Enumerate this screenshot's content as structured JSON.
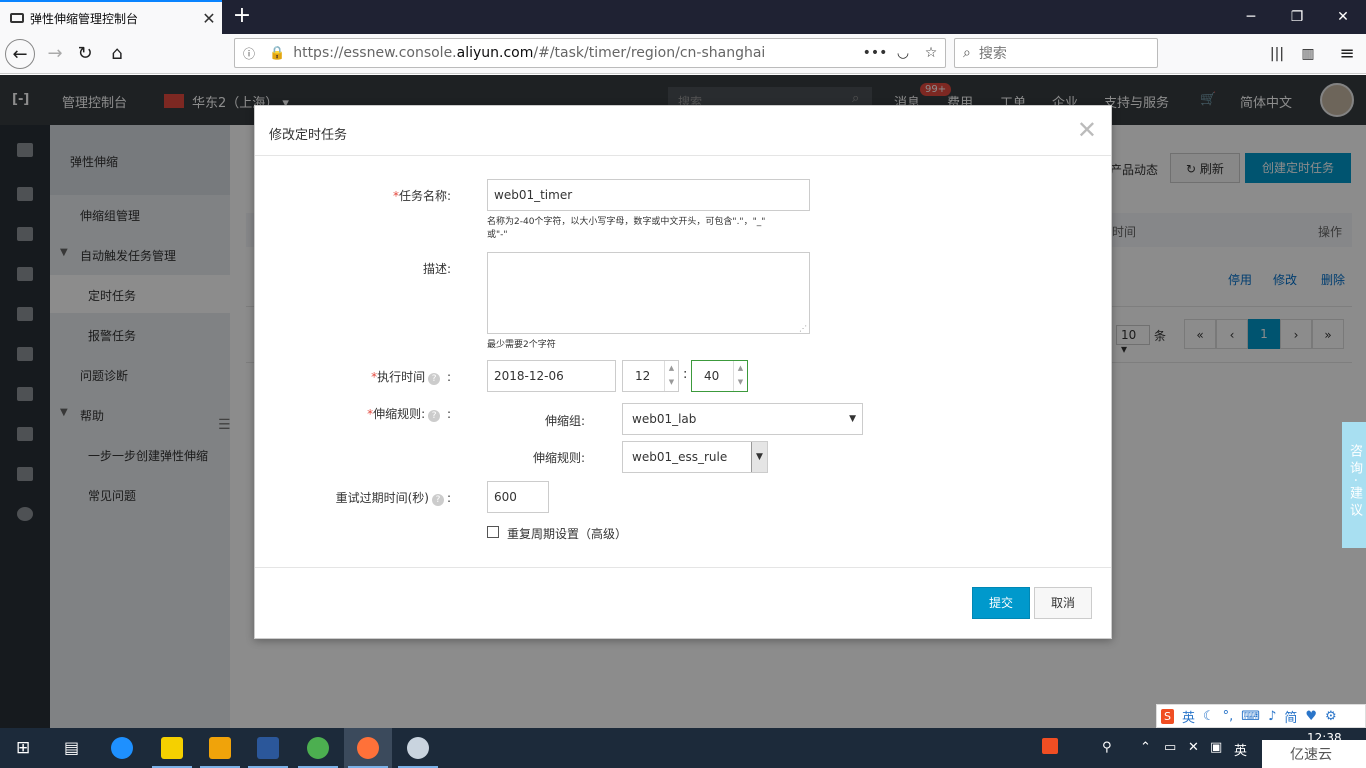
{
  "browser": {
    "tab_title": "弹性伸缩管理控制台",
    "url_prefix": "https://essnew.console.",
    "url_domain": "aliyun.com",
    "url_suffix": "/#/task/timer/region/cn-shanghai",
    "search_placeholder": "搜索"
  },
  "topbar": {
    "console": "管理控制台",
    "region": "华东2（上海）",
    "search_placeholder": "搜索",
    "messages": "消息",
    "messages_badge": "99+",
    "billing": "费用",
    "tickets": "工单",
    "enterprise": "企业",
    "support": "支持与服务",
    "language": "简体中文"
  },
  "sidebar": {
    "header": "弹性伸缩",
    "items": [
      {
        "label": "伸缩组管理"
      },
      {
        "label": "自动触发任务管理"
      },
      {
        "label": "定时任务"
      },
      {
        "label": "报警任务"
      },
      {
        "label": "问题诊断"
      },
      {
        "label": "帮助"
      },
      {
        "label": "一步一步创建弹性伸缩"
      },
      {
        "label": "常见问题"
      }
    ]
  },
  "page": {
    "product_news": "产品动态",
    "refresh": "刷新",
    "create_task": "创建定时任务",
    "col_time": "时间",
    "col_ops": "操作",
    "op_disable": "停用",
    "op_modify": "修改",
    "op_delete": "删除",
    "page_size": "10",
    "page_size_unit": "条",
    "page_first": "«",
    "page_prev": "‹",
    "page_current": "1",
    "page_next": "›",
    "page_last": "»"
  },
  "modal": {
    "title": "修改定时任务",
    "name_label": "任务名称:",
    "name_value": "web01_timer",
    "name_hint_1": "名称为2-40个字符，以大小写字母，数字或中文开头，可包含\".\"，\"_\"",
    "name_hint_2": "或\"-\"",
    "desc_label": "描述:",
    "desc_hint": "最少需要2个字符",
    "time_label": "执行时间",
    "date_value": "2018-12-06",
    "hour_value": "12",
    "minute_value": "40",
    "rule_label": "伸缩规则:",
    "group_label": "伸缩组:",
    "group_value": "web01_lab",
    "rule_sub_label": "伸缩规则:",
    "rule_value": "web01_ess_rule",
    "retry_label": "重试过期时间(秒)",
    "retry_value": "600",
    "repeat_label": "重复周期设置（高级）",
    "submit": "提交",
    "cancel": "取消"
  },
  "consult": {
    "label": "咨询·建议"
  },
  "ime": {
    "mode": "英",
    "simp": "简"
  },
  "taskbar": {
    "lang": "英",
    "clock": "12:38",
    "watermark": "亿速云"
  }
}
